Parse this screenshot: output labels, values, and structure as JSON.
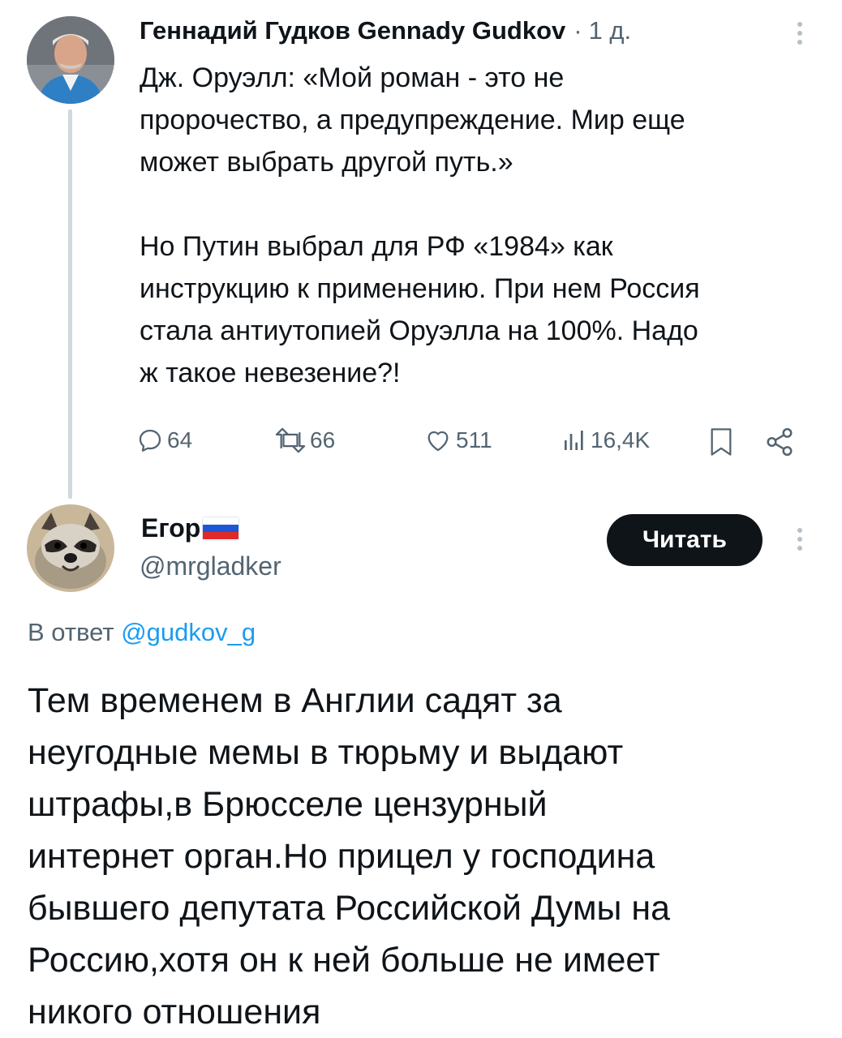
{
  "tweet": {
    "author_name": "Геннадий Гудков Gennady Gudkov",
    "separator": "·",
    "time": "1 д.",
    "avatar_icon": "person-avatar-icon",
    "text_lines": [
      "Дж. Оруэлл: «Мой роман - это не",
      "пророчество, а предупреждение. Мир еще",
      "может выбрать другой путь.»",
      "",
      "Но Путин выбрал для РФ  «1984» как",
      "инструкцию к применению. При нем Россия",
      "стала антиутопией Оруэлла на 100%. Надо",
      "ж такое невезение?!"
    ],
    "actions": {
      "replies": "64",
      "reposts": "66",
      "likes": "511",
      "views": "16,4K"
    }
  },
  "reply": {
    "author_name": "Егор",
    "handle": "@mrgladker",
    "follow_label": "Читать",
    "avatar_icon": "raccoon-avatar-icon",
    "reply_prefix": "В ответ",
    "reply_mention": "@gudkov_g",
    "text_lines": [
      "Тем временем в Англии садят за",
      "неугодные мемы в тюрьму и выдают",
      "штрафы,в Брюсселе цензурный",
      "интернет орган.Но прицел у господина",
      "бывшего депутата Российской Думы на",
      "Россию,хотя он к ней больше не имеет",
      "никого отношения"
    ]
  },
  "colors": {
    "text": "#0f1419",
    "secondary": "#536471",
    "link": "#1d9bf0",
    "button": "#0f1419",
    "thread_line": "#cfd9de"
  }
}
